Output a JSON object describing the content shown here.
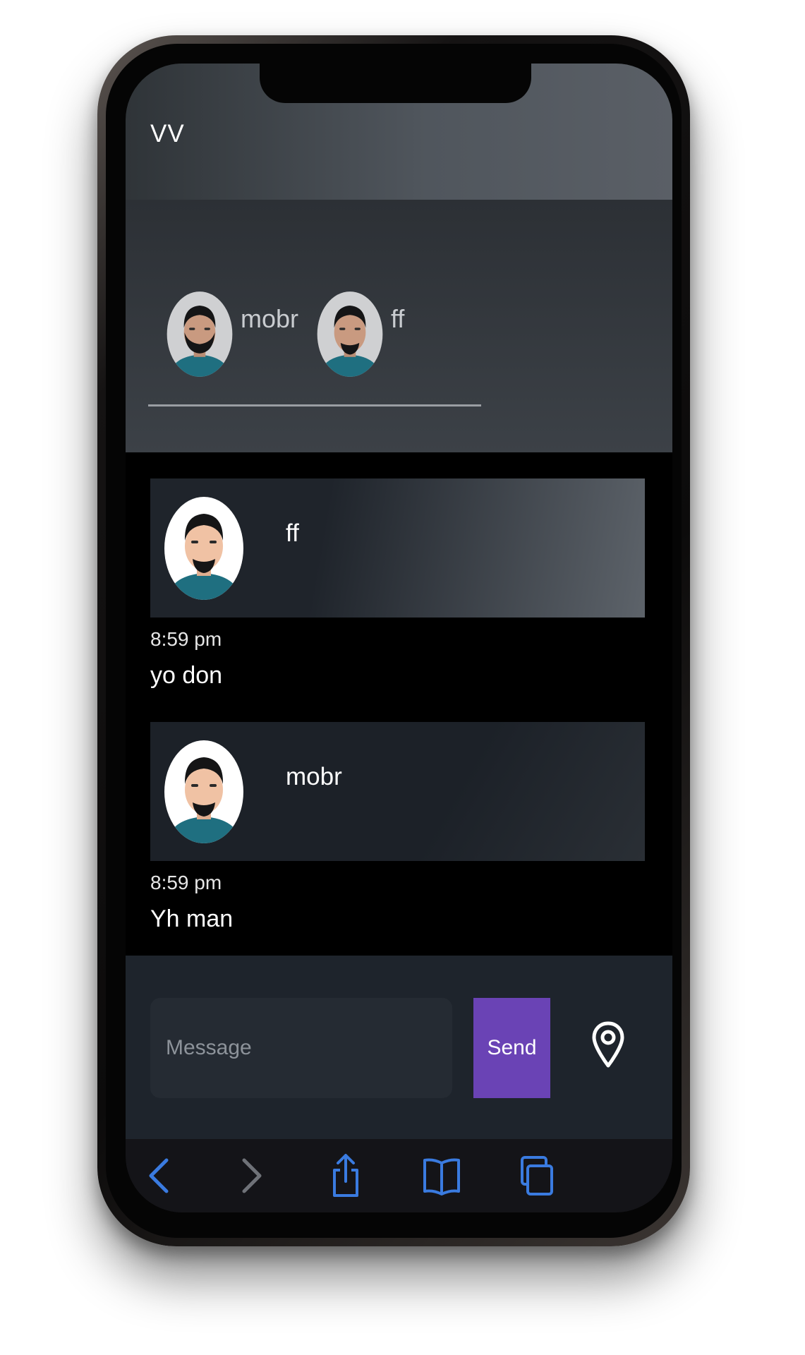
{
  "app": {
    "title": "VV"
  },
  "users": [
    {
      "name": "mobr"
    },
    {
      "name": "ff"
    }
  ],
  "messages": [
    {
      "sender": "ff",
      "time": "8:59 pm",
      "text": "yo don"
    },
    {
      "sender": "mobr",
      "time": "8:59 pm",
      "text": "Yh man"
    }
  ],
  "composer": {
    "placeholder": "Message",
    "send_label": "Send",
    "location_icon": "location-pin-icon"
  },
  "toolbar": {
    "icons": [
      "back-chevron-icon",
      "forward-chevron-icon",
      "share-icon",
      "bookmarks-icon",
      "tabs-icon"
    ]
  },
  "colors": {
    "accent": "#6a43b5",
    "toolbar_icon": "#3a7be0",
    "toolbar_icon_disabled": "#6f7278",
    "composer_bg": "#1e242c"
  }
}
